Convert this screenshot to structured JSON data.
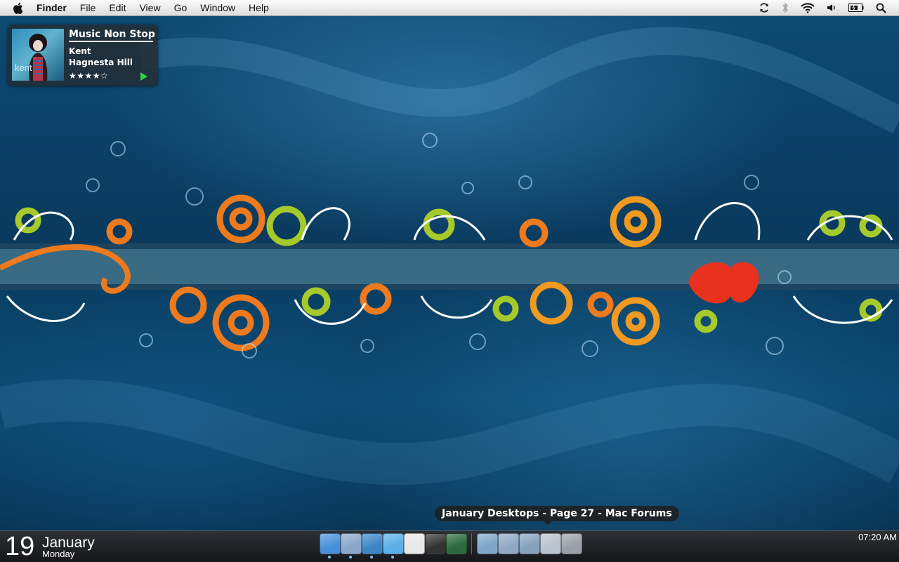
{
  "menubar": {
    "apple_icon": "apple-icon",
    "items": [
      "Finder",
      "File",
      "Edit",
      "View",
      "Go",
      "Window",
      "Help"
    ],
    "status_icons": [
      "sync-icon",
      "bluetooth-icon",
      "wifi-icon",
      "volume-icon",
      "battery-icon",
      "spotlight-icon"
    ]
  },
  "music_widget": {
    "title": "Music Non Stop",
    "artist": "Kent",
    "album": "Hagnesta Hill",
    "rating": "★★★★☆",
    "cover_text": "kent",
    "play_color": "#33d04a"
  },
  "dock": {
    "date": {
      "day": "19",
      "month": "January",
      "weekday": "Monday"
    },
    "clock": "07:20 AM",
    "tooltip": "January Desktops - Page 27 - Mac Forums",
    "apps": [
      {
        "name": "finder-icon",
        "color": "#4a90d9",
        "running": true
      },
      {
        "name": "preview-icon",
        "color": "#8aa7c8",
        "running": true
      },
      {
        "name": "safari-icon",
        "color": "#3d86c6",
        "running": true
      },
      {
        "name": "itunes-icon",
        "color": "#5ab0e8",
        "running": true
      },
      {
        "name": "ical-icon",
        "color": "#e8e8e8",
        "running": false
      },
      {
        "name": "facetime-icon",
        "color": "#333333",
        "running": false
      },
      {
        "name": "time-machine-icon",
        "color": "#2b6a3e",
        "running": false
      },
      {
        "name": "applications-folder-icon",
        "color": "#7fa6c9",
        "running": false
      },
      {
        "name": "documents-folder-icon",
        "color": "#8fa9c3",
        "running": false
      },
      {
        "name": "downloads-folder-icon",
        "color": "#86a3bd",
        "running": false
      },
      {
        "name": "mail-stack-icon",
        "color": "#b9c3cd",
        "running": false
      },
      {
        "name": "trash-icon",
        "color": "#9aa0a6",
        "running": false
      }
    ]
  }
}
